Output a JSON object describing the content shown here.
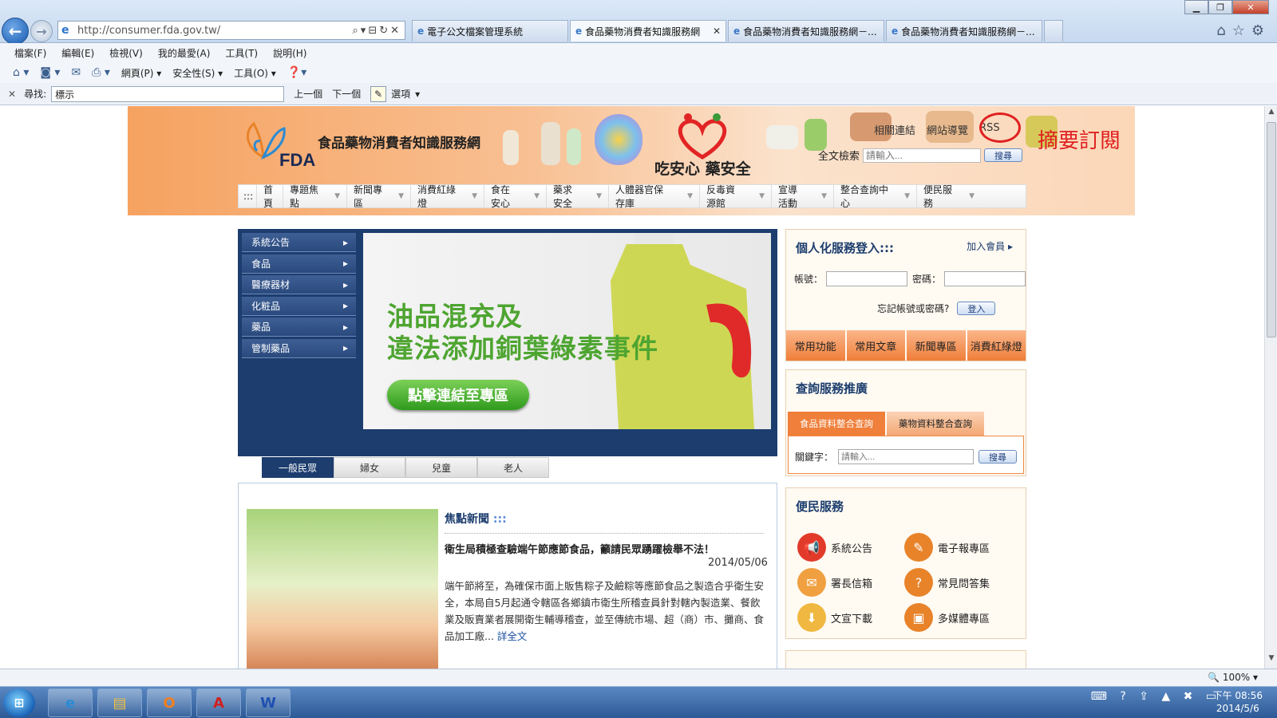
{
  "browser": {
    "address": {
      "url": "http://consumer.fda.gov.tw/"
    },
    "tabs": [
      {
        "label": "電子公文檔案管理系統"
      },
      {
        "label": "食品藥物消費者知識服務網"
      },
      {
        "label": "食品藥物消費者知識服務網－..."
      },
      {
        "label": "食品藥物消費者知識服務網－..."
      }
    ],
    "menu": [
      "檔案(F)",
      "編輯(E)",
      "檢視(V)",
      "我的最愛(A)",
      "工具(T)",
      "說明(H)"
    ],
    "commands": [
      "網頁(P)",
      "安全性(S)",
      "工具(O)"
    ],
    "find": {
      "label": "尋找:",
      "value": "標示",
      "prev": "上一個",
      "next": "下一個",
      "options": "選項"
    },
    "zoom": "100%"
  },
  "site": {
    "name": "食品藥物消費者知識服務網",
    "logo_text": "FDA",
    "slogan": "吃安心 藥安全",
    "toplinks": [
      "相關連結",
      "網站導覽",
      "RSS"
    ],
    "rss_note": "摘要訂閱",
    "search": {
      "label": "全文檢索",
      "placeholder": "請輸入...",
      "button": "搜尋"
    },
    "nav": [
      ":::",
      "首頁",
      "專題焦點",
      "新聞專區",
      "消費紅綠燈",
      "食在安心",
      "藥求安全",
      "人體器官保存庫",
      "反毒資源館",
      "宣導活動",
      "整合查詢中心",
      "便民服務"
    ],
    "categories": [
      "系統公告",
      "食品",
      "醫療器材",
      "化粧品",
      "藥品",
      "管制藥品"
    ],
    "banner": {
      "line1": "油品混充及",
      "line2": "違法添加銅葉綠素事件",
      "button": "點擊連結至專區"
    },
    "audience_tabs": [
      "一般民眾",
      "婦女",
      "兒童",
      "老人"
    ],
    "news": {
      "title": "焦點新聞",
      "title_suffix": ":::",
      "headline": "衛生局積極查驗端午節應節食品，籲請民眾踴躍檢舉不法！",
      "date": "2014/05/06",
      "body": "端午節將至，為確保市面上販售粽子及鹼粽等應節食品之製造合乎衛生安全，本局自5月起通令轄區各鄉鎮市衛生所稽查員針對轄內製造業、餐飲業及販賣業者展開衛生輔導稽查，並至傳統市場、超（商）市、攤商、食品加工廠...",
      "more": "詳全文"
    },
    "login": {
      "title": "個人化服務登入:::",
      "join": "加入會員",
      "account": "帳號：",
      "password": "密碼：",
      "forgot": "忘記帳號或密碼?",
      "login_btn": "登入",
      "tabs": [
        "常用功能",
        "常用文章",
        "新聞專區",
        "消費紅綠燈"
      ]
    },
    "query": {
      "title": "查詢服務推廣",
      "tabs": [
        "食品資料整合查詢",
        "藥物資料整合查詢"
      ],
      "label": "關鍵字：",
      "placeholder": "請輸入...",
      "button": "搜尋"
    },
    "services": {
      "title": "便民服務",
      "items": [
        "系統公告",
        "電子報專區",
        "署長信箱",
        "常見問答集",
        "文宣下載",
        "多媒體專區"
      ]
    }
  },
  "taskbar": {
    "time": "下午 08:56",
    "date": "2014/5/6"
  },
  "colors": {
    "navy": "#1c3d6e",
    "orange": "#ef7f3a",
    "green": "#4ea531",
    "rss_circle": "#e02020"
  }
}
